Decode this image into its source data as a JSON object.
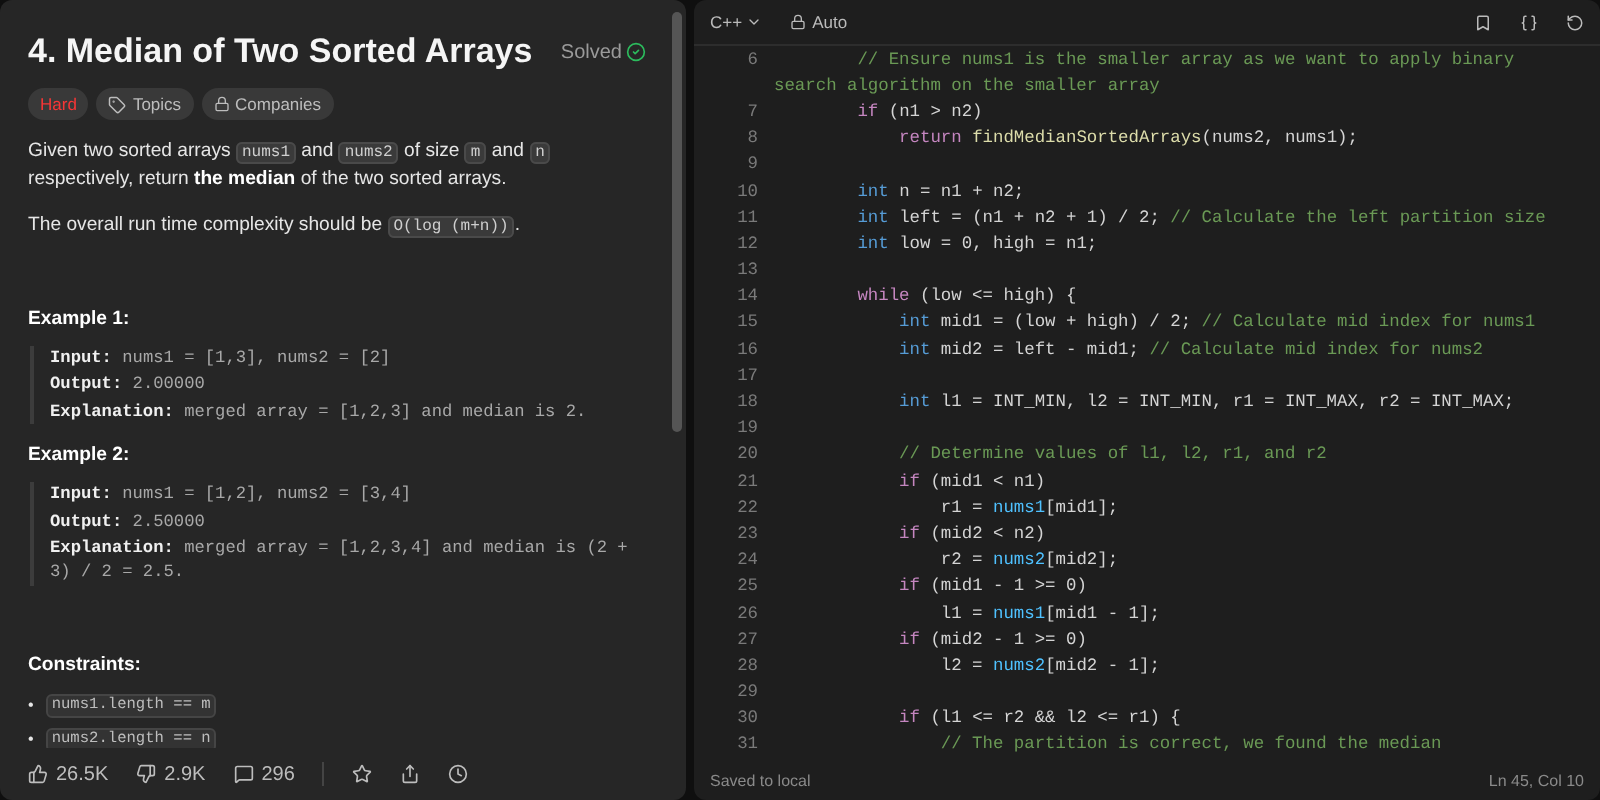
{
  "problem": {
    "title": "4. Median of Two Sorted Arrays",
    "status": "Solved",
    "tags": [
      {
        "kind": "difficulty",
        "label": "Hard"
      },
      {
        "kind": "topics",
        "label": "Topics"
      },
      {
        "kind": "companies",
        "label": "Companies"
      }
    ],
    "paragraphs": [
      [
        {
          "kind": "text",
          "t": "Given two sorted arrays "
        },
        {
          "kind": "code",
          "t": "nums1"
        },
        {
          "kind": "text",
          "t": " and "
        },
        {
          "kind": "code",
          "t": "nums2"
        },
        {
          "kind": "text",
          "t": " of size "
        },
        {
          "kind": "code",
          "t": "m"
        },
        {
          "kind": "text",
          "t": " and "
        },
        {
          "kind": "code",
          "t": "n"
        },
        {
          "kind": "text",
          "t": " respectively, return "
        },
        {
          "kind": "bold",
          "t": "the median"
        },
        {
          "kind": "text",
          "t": " of the two sorted arrays."
        }
      ],
      [
        {
          "kind": "text",
          "t": "The overall run time complexity should be "
        },
        {
          "kind": "code",
          "t": "O(log (m+n))"
        },
        {
          "kind": "text",
          "t": "."
        }
      ]
    ],
    "examples": [
      {
        "title": "Example 1:",
        "rows": [
          {
            "label": "Input:",
            "value": "nums1 = [1,3], nums2 = [2]"
          },
          {
            "label": "Output:",
            "value": "2.00000"
          },
          {
            "label": "Explanation:",
            "value": "merged array = [1,2,3] and median is 2."
          }
        ]
      },
      {
        "title": "Example 2:",
        "rows": [
          {
            "label": "Input:",
            "value": "nums1 = [1,2], nums2 = [3,4]"
          },
          {
            "label": "Output:",
            "value": "2.50000"
          },
          {
            "label": "Explanation:",
            "value": "merged array = [1,2,3,4] and median is (2 + 3) / 2 = 2.5."
          }
        ]
      }
    ],
    "constraints_title": "Constraints:",
    "constraints": [
      {
        "marker": "•",
        "code": "nums1.length == m"
      },
      {
        "marker": "•",
        "code": "nums2.length == n"
      }
    ],
    "stats": {
      "likes": "26.5K",
      "dislikes": "2.9K",
      "comments": "296"
    }
  },
  "editor": {
    "language": "C++",
    "mode": "Auto",
    "status": "Saved to local",
    "cursor": "Ln 45, Col 10",
    "lines": [
      {
        "number": "6",
        "tokens": [
          {
            "kind": "cm",
            "t": "        // Ensure nums1 is the smaller array as we want to apply binary"
          }
        ]
      },
      {
        "tokens": [
          {
            "kind": "cm",
            "t": "search algorithm on the smaller array"
          }
        ]
      },
      {
        "number": "7",
        "tokens": [
          {
            "kind": "kw",
            "t": "        if"
          },
          {
            "kind": "p",
            "t": " (n1 > n2)"
          }
        ]
      },
      {
        "number": "8",
        "tokens": [
          {
            "kind": "kw",
            "t": "            return "
          },
          {
            "kind": "fn",
            "t": "findMedianSortedArrays"
          },
          {
            "kind": "p",
            "t": "(nums2, nums1);"
          }
        ]
      },
      {
        "number": "9"
      },
      {
        "number": "10",
        "tokens": [
          {
            "kind": "ty",
            "t": "        int"
          },
          {
            "kind": "p",
            "t": " n = n1 + n2;"
          }
        ]
      },
      {
        "number": "11",
        "tokens": [
          {
            "kind": "ty",
            "t": "        int"
          },
          {
            "kind": "p",
            "t": " left = (n1 + n2 + 1) / 2; "
          },
          {
            "kind": "cm",
            "t": "// Calculate the left partition size"
          }
        ]
      },
      {
        "number": "12",
        "tokens": [
          {
            "kind": "ty",
            "t": "        int"
          },
          {
            "kind": "p",
            "t": " low = 0, high = n1;"
          }
        ]
      },
      {
        "number": "13"
      },
      {
        "number": "14",
        "tokens": [
          {
            "kind": "kw",
            "t": "        while"
          },
          {
            "kind": "p",
            "t": " (low <= high) {"
          }
        ]
      },
      {
        "number": "15",
        "tokens": [
          {
            "kind": "ty",
            "t": "            int"
          },
          {
            "kind": "p",
            "t": " mid1 = (low + high) / 2; "
          },
          {
            "kind": "cm",
            "t": "// Calculate mid index for nums1"
          }
        ]
      },
      {
        "number": "16",
        "tokens": [
          {
            "kind": "ty",
            "t": "            int"
          },
          {
            "kind": "p",
            "t": " mid2 = left - mid1; "
          },
          {
            "kind": "cm",
            "t": "// Calculate mid index for nums2"
          }
        ]
      },
      {
        "number": "17"
      },
      {
        "number": "18",
        "tokens": [
          {
            "kind": "ty",
            "t": "            int"
          },
          {
            "kind": "p",
            "t": " l1 = INT_MIN, l2 = INT_MIN, r1 = INT_MAX, r2 = INT_MAX;"
          }
        ]
      },
      {
        "number": "19"
      },
      {
        "number": "20",
        "tokens": [
          {
            "kind": "cm",
            "t": "            // Determine values of l1, l2, r1, and r2"
          }
        ]
      },
      {
        "number": "21",
        "tokens": [
          {
            "kind": "kw",
            "t": "            if"
          },
          {
            "kind": "p",
            "t": " (mid1 < n1)"
          }
        ]
      },
      {
        "number": "22",
        "tokens": [
          {
            "kind": "p",
            "t": "                r1 = "
          },
          {
            "kind": "var",
            "t": "nums1"
          },
          {
            "kind": "p",
            "t": "[mid1];"
          }
        ]
      },
      {
        "number": "23",
        "tokens": [
          {
            "kind": "kw",
            "t": "            if"
          },
          {
            "kind": "p",
            "t": " (mid2 < n2)"
          }
        ]
      },
      {
        "number": "24",
        "tokens": [
          {
            "kind": "p",
            "t": "                r2 = "
          },
          {
            "kind": "var",
            "t": "nums2"
          },
          {
            "kind": "p",
            "t": "[mid2];"
          }
        ]
      },
      {
        "number": "25",
        "tokens": [
          {
            "kind": "kw",
            "t": "            if"
          },
          {
            "kind": "p",
            "t": " (mid1 - 1 >= 0)"
          }
        ]
      },
      {
        "number": "26",
        "tokens": [
          {
            "kind": "p",
            "t": "                l1 = "
          },
          {
            "kind": "var",
            "t": "nums1"
          },
          {
            "kind": "p",
            "t": "[mid1 - 1];"
          }
        ]
      },
      {
        "number": "27",
        "tokens": [
          {
            "kind": "kw",
            "t": "            if"
          },
          {
            "kind": "p",
            "t": " (mid2 - 1 >= 0)"
          }
        ]
      },
      {
        "number": "28",
        "tokens": [
          {
            "kind": "p",
            "t": "                l2 = "
          },
          {
            "kind": "var",
            "t": "nums2"
          },
          {
            "kind": "p",
            "t": "[mid2 - 1];"
          }
        ]
      },
      {
        "number": "29"
      },
      {
        "number": "30",
        "tokens": [
          {
            "kind": "kw",
            "t": "            if"
          },
          {
            "kind": "p",
            "t": " (l1 <= r2 && l2 <= r1) {"
          }
        ]
      },
      {
        "number": "31",
        "tokens": [
          {
            "kind": "cm",
            "t": "                // The partition is correct, we found the median"
          }
        ]
      }
    ]
  }
}
